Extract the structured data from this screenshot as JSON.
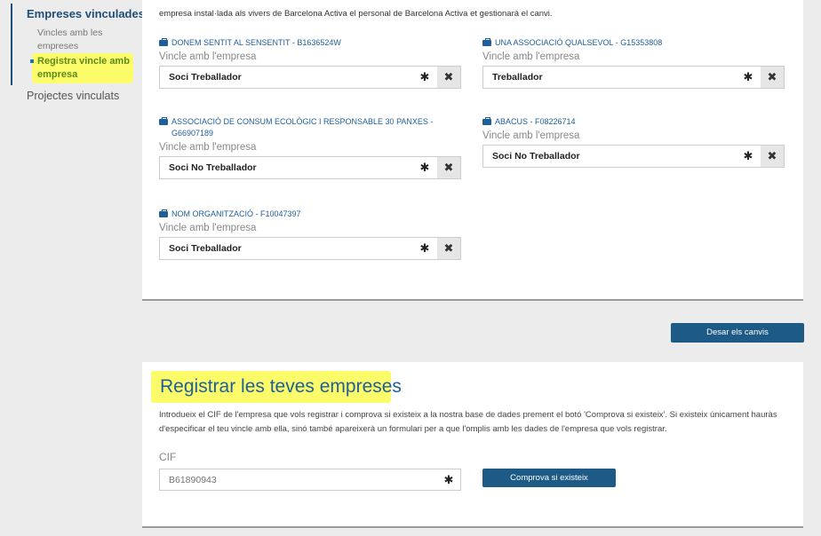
{
  "sidebar": {
    "title": "Empreses vinculades",
    "sub_item": "Vincles amb les empreses",
    "active_item": "Registra vincle amb empresa",
    "projects": "Projectes vinculats"
  },
  "intro_text": "empresa instal·lada als vivers de Barcelona Activa el personal de Barcelona Activa et gestionarà el canvi.",
  "relation_label": "Vincle amb l'empresa",
  "entities": [
    {
      "name": "DONEM SENTIT AL SENSENTIT - B1636524W",
      "relation": "Soci Treballador"
    },
    {
      "name": "UNA ASSOCIACIÓ QUALSEVOL - G15353808",
      "relation": "Treballador"
    },
    {
      "name": "ASSOCIACIÓ DE CONSUM ECOLÒGIC I RESPONSABLE 30 PANXES - G66907189",
      "relation": "Soci No Treballador"
    },
    {
      "name": "ABACUS - F08226714",
      "relation": "Soci No Treballador"
    },
    {
      "name": "NOM ORGANITZACIÓ - F10047397",
      "relation": "Soci Treballador"
    }
  ],
  "required_mark": "✱",
  "remove_mark": "✖",
  "discard_button": "Desar els canvis",
  "register": {
    "title": "Registrar les teves empreses",
    "description": "Introdueix el CIF de l'empresa que vols registrar i comprova si existeix a la nostra base de dades prement el botó 'Comprova si existeix'. Si existeix únicament hauràs d'especificar el teu vincle amb ella, sinó també apareixerà un formulari per a que l'omplis amb les dades de l'empresa que vols registrar.",
    "cif_label": "CIF",
    "cif_placeholder": "B61890943",
    "check_button": "Comprova si existeix"
  },
  "colors": {
    "accent": "#1d5a86",
    "highlight": "#fcfc6a",
    "link": "#1f5f99"
  }
}
